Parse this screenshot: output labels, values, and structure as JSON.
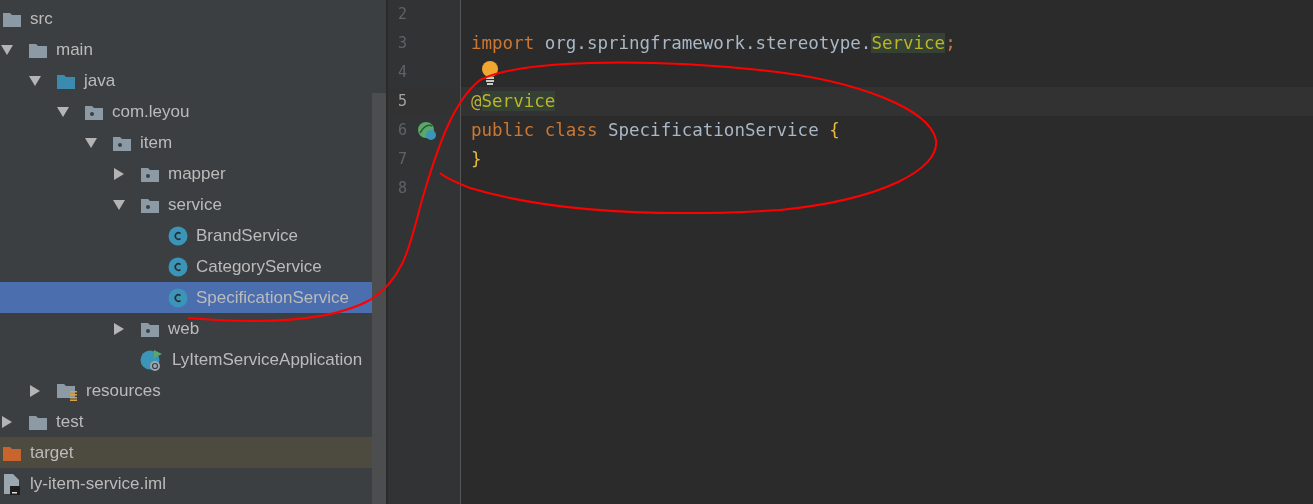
{
  "project_tree": [
    {
      "label": "src",
      "kind": "folder",
      "children": [
        {
          "label": "main",
          "kind": "folder",
          "expanded": true,
          "children": [
            {
              "label": "java",
              "kind": "source-folder",
              "expanded": true,
              "children": [
                {
                  "label": "com.leyou",
                  "kind": "package",
                  "expanded": true,
                  "children": [
                    {
                      "label": "item",
                      "kind": "package",
                      "expanded": true,
                      "children": [
                        {
                          "label": "mapper",
                          "kind": "package",
                          "expanded": false,
                          "selected": false
                        },
                        {
                          "label": "service",
                          "kind": "package",
                          "expanded": true,
                          "children": [
                            {
                              "label": "BrandService",
                              "kind": "class",
                              "selected": false
                            },
                            {
                              "label": "CategoryService",
                              "kind": "class",
                              "selected": false
                            },
                            {
                              "label": "SpecificationService",
                              "kind": "class",
                              "selected": true
                            }
                          ]
                        },
                        {
                          "label": "web",
                          "kind": "package",
                          "expanded": false,
                          "selected": false
                        },
                        {
                          "label": "LyItemServiceApplication",
                          "kind": "app-class",
                          "selected": false
                        }
                      ]
                    }
                  ]
                }
              ]
            },
            {
              "label": "resources",
              "kind": "resource-folder",
              "expanded": false,
              "selected": false
            }
          ]
        },
        {
          "label": "test",
          "kind": "folder",
          "expanded": false,
          "selected": false
        }
      ]
    },
    {
      "label": "target",
      "kind": "excluded-folder",
      "selected": false
    },
    {
      "label": "ly-item-service.iml",
      "kind": "file",
      "selected": false
    }
  ],
  "editor": {
    "lines": [
      {
        "number": "2",
        "current": false
      },
      {
        "number": "3",
        "current": false,
        "segments": [
          {
            "text": "import ",
            "kind": "keyword"
          },
          {
            "text": "org.springframework.stereotype.",
            "kind": "plain"
          },
          {
            "text": "Service",
            "kind": "annotation",
            "highlight": true
          },
          {
            "text": ";",
            "kind": "keyword",
            "highlight": false
          }
        ]
      },
      {
        "number": "4",
        "current": false,
        "kind": "bulb"
      },
      {
        "number": "5",
        "current": true,
        "segments": [
          {
            "text": "@",
            "kind": "annotation",
            "highlight": false
          },
          {
            "text": "Service",
            "kind": "annotation",
            "highlight": true
          }
        ]
      },
      {
        "number": "6",
        "current": false,
        "kind": "bean",
        "segments": [
          {
            "text": "public class ",
            "kind": "keyword"
          },
          {
            "text": "SpecificationService ",
            "kind": "plain"
          },
          {
            "text": "{",
            "kind": "brace"
          }
        ]
      },
      {
        "number": "7",
        "current": false,
        "segments": [
          {
            "text": "}",
            "kind": "brace"
          }
        ]
      },
      {
        "number": "8",
        "current": false
      }
    ]
  }
}
